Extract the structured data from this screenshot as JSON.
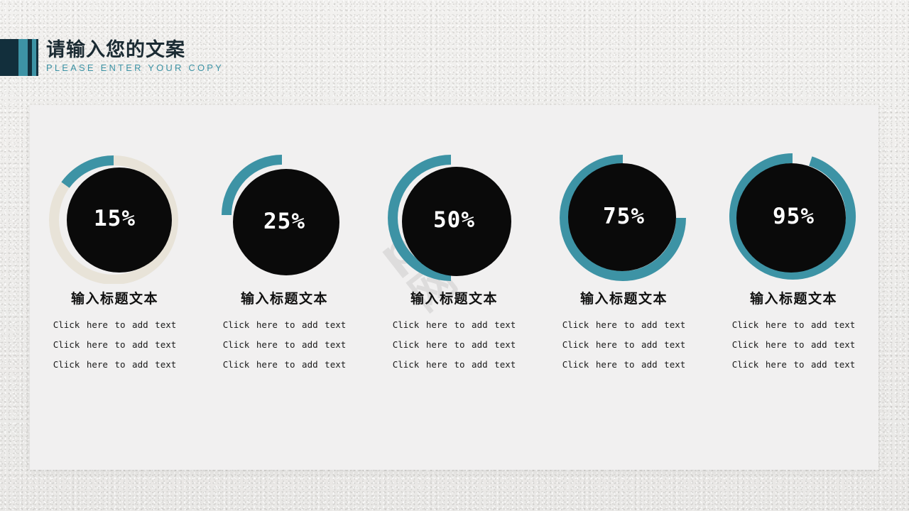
{
  "header": {
    "title_cn": "请输入您的文案",
    "title_en": "PLEASE ENTER YOUR COPY",
    "accent_dark": "#122f3c",
    "accent_teal": "#3d93a5"
  },
  "watermark": {
    "text": "ppt示网"
  },
  "theme": {
    "teal": "#3d93a5",
    "cream": "#e8e3d8",
    "disc": "#0a0a0a",
    "panel_bg": "#f1f0f0",
    "slide_bg": "#eeedeb"
  },
  "chart_data": {
    "type": "pie",
    "title": "请输入您的文案",
    "subtitle": "PLEASE ENTER YOUR COPY",
    "categories": [
      "输入标题文本",
      "输入标题文本",
      "输入标题文本",
      "输入标题文本",
      "输入标题文本"
    ],
    "values": [
      15,
      25,
      50,
      75,
      95
    ],
    "labels": [
      "15%",
      "25%",
      "50%",
      "75%",
      "95%"
    ],
    "unit": "%",
    "ylim": [
      0,
      100
    ],
    "grid": false,
    "legend": "none",
    "arc_direction": "counterclockwise",
    "arc_start_deg": 0,
    "track_colors": [
      "#e8e3d8",
      "none",
      "none",
      "none",
      "none"
    ],
    "arc_color": "#3d93a5"
  },
  "columns": [
    {
      "percent": "15%",
      "value": 15,
      "title": "输入标题文本",
      "body": "Click here to add text Click here to add text Click here to add text",
      "has_track": true
    },
    {
      "percent": "25%",
      "value": 25,
      "title": "输入标题文本",
      "body": "Click here to add text Click here to add text Click here to add text",
      "has_track": false
    },
    {
      "percent": "50%",
      "value": 50,
      "title": "输入标题文本",
      "body": "Click here to add text Click here to add text Click here to add text",
      "has_track": false
    },
    {
      "percent": "75%",
      "value": 75,
      "title": "输入标题文本",
      "body": "Click here to add text Click here to add text Click here to add text",
      "has_track": false
    },
    {
      "percent": "95%",
      "value": 95,
      "title": "输入标题文本",
      "body": "Click here to add text Click here to add text Click here to add text",
      "has_track": false
    }
  ]
}
